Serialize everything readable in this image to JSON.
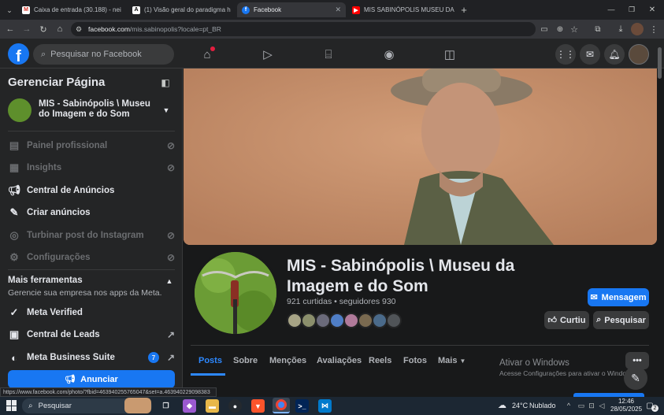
{
  "browser": {
    "tabs": [
      {
        "title": "Caixa de entrada (30.188) - nei",
        "favicon": "gmail-icon"
      },
      {
        "title": "(1) Visão geral do paradigma h",
        "favicon": "academia-icon"
      },
      {
        "title": "Facebook",
        "favicon": "facebook-icon"
      },
      {
        "title": "MIS SABINÓPOLIS MUSEU DA",
        "favicon": "youtube-icon"
      }
    ],
    "url_host": "facebook.com",
    "url_path": "/mis.sabinopolis?locale=pt_BR",
    "status_url": "https://www.facebook.com/photo/?fbid=463940255765047&set=a.463940229098383"
  },
  "facebook": {
    "search_placeholder": "Pesquisar no Facebook"
  },
  "sidebar": {
    "title": "Gerenciar Página",
    "page_name": "MIS - Sabinópolis \\ Museu do Imagem e do Som",
    "items": [
      {
        "label": "Painel profissional",
        "icon": "dashboard-icon",
        "disabled": true
      },
      {
        "label": "Insights",
        "icon": "insights-icon",
        "disabled": true
      },
      {
        "label": "Central de Anúncios",
        "icon": "megaphone-icon",
        "disabled": false
      },
      {
        "label": "Criar anúncios",
        "icon": "edit-icon",
        "disabled": false
      },
      {
        "label": "Turbinar post do Instagram",
        "icon": "instagram-icon",
        "disabled": true
      },
      {
        "label": "Configurações",
        "icon": "gear-icon",
        "disabled": true
      }
    ],
    "tools_title": "Mais ferramentas",
    "tools_sub": "Gerencie sua empresa nos apps da Meta.",
    "tools": [
      {
        "label": "Meta Verified",
        "icon": "verified-icon"
      },
      {
        "label": "Central de Leads",
        "icon": "leads-icon"
      },
      {
        "label": "Meta Business Suite",
        "icon": "business-icon",
        "badge": "7"
      }
    ],
    "advertise_label": "Anunciar"
  },
  "page": {
    "name": "MIS - Sabinópolis \\ Museu da Imagem e do Som",
    "stats": "921 curtidas • seguidores 930",
    "message_btn": "Mensagem",
    "like_btn": "Curtiu",
    "search_btn": "Pesquisar",
    "tabs": [
      "Posts",
      "Sobre",
      "Menções",
      "Avaliações",
      "Reels",
      "Fotos",
      "Mais"
    ],
    "windows_title": "Ativar o Windows",
    "windows_sub": "Acesse Configurações para ativar o Windows."
  },
  "taskbar": {
    "search": "Pesquisar",
    "weather": "24°C",
    "weather_desc": "Nublado",
    "time": "12:46",
    "date": "28/05/2025",
    "notifications": "2"
  },
  "colors": {
    "accent": "#1877f2",
    "bg": "#18191a",
    "panel": "#242526"
  }
}
